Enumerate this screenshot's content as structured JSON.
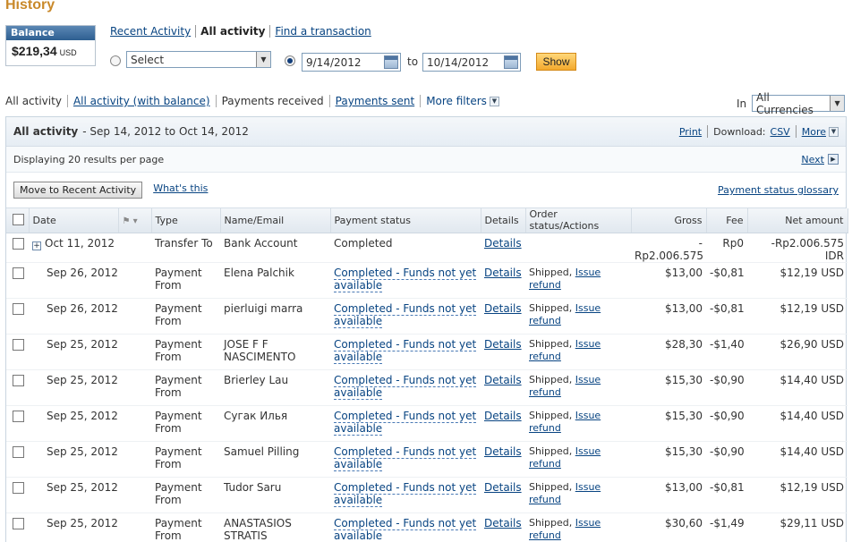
{
  "page_title": "History",
  "balance": {
    "label": "Balance",
    "amount": "$219,34",
    "currency": "USD"
  },
  "top_tabs": {
    "recent": "Recent Activity",
    "all": "All activity",
    "find": "Find a transaction"
  },
  "select": {
    "value": "Select"
  },
  "dates": {
    "from": "9/14/2012",
    "to_label": "to",
    "to": "10/14/2012"
  },
  "show_button": "Show",
  "filter_tabs": {
    "all": "All activity",
    "all_balance": "All activity (with balance)",
    "received": "Payments received",
    "sent": "Payments sent",
    "more": "More filters"
  },
  "currency": {
    "in_label": "In",
    "value": "All Currencies"
  },
  "panel": {
    "title": "All activity",
    "range": "- Sep 14, 2012 to Oct 14, 2012",
    "print": "Print",
    "download_label": "Download:",
    "csv": "CSV",
    "more": "More",
    "displaying": "Displaying 20 results per page",
    "next": "Next",
    "move_button": "Move to Recent Activity",
    "whats_this": "What's this",
    "glossary": "Payment status glossary"
  },
  "columns": {
    "date": "Date",
    "type": "Type",
    "name": "Name/Email",
    "status": "Payment status",
    "details": "Details",
    "order": "Order status/Actions",
    "gross": "Gross",
    "fee": "Fee",
    "net": "Net amount"
  },
  "rows": [
    {
      "date": "Oct 11, 2012",
      "type1": "Transfer To",
      "type2": "",
      "name1": "Bank Account",
      "name2": "",
      "status1": "Completed",
      "status2": "",
      "details": "Details",
      "order": "",
      "refund": "",
      "gross": "-Rp2.006.575",
      "fee": "Rp0",
      "net": "-Rp2.006.575 IDR"
    },
    {
      "date": "Sep 26, 2012",
      "type1": "Payment",
      "type2": "From",
      "name1": "Elena Palchik",
      "name2": "",
      "status1": "Completed - Funds not yet",
      "status2": "available",
      "details": "Details",
      "order": "Shipped,",
      "refund": "Issue refund",
      "gross": "$13,00",
      "fee": "-$0,81",
      "net": "$12,19 USD"
    },
    {
      "date": "Sep 26, 2012",
      "type1": "Payment",
      "type2": "From",
      "name1": "pierluigi marra",
      "name2": "",
      "status1": "Completed - Funds not yet",
      "status2": "available",
      "details": "Details",
      "order": "Shipped,",
      "refund": "Issue refund",
      "gross": "$13,00",
      "fee": "-$0,81",
      "net": "$12,19 USD"
    },
    {
      "date": "Sep 25, 2012",
      "type1": "Payment",
      "type2": "From",
      "name1": "JOSE F F",
      "name2": "NASCIMENTO",
      "status1": "Completed - Funds not yet",
      "status2": "available",
      "details": "Details",
      "order": "Shipped,",
      "refund": "Issue refund",
      "gross": "$28,30",
      "fee": "-$1,40",
      "net": "$26,90 USD"
    },
    {
      "date": "Sep 25, 2012",
      "type1": "Payment",
      "type2": "From",
      "name1": "Brierley Lau",
      "name2": "",
      "status1": "Completed - Funds not yet",
      "status2": "available",
      "details": "Details",
      "order": "Shipped,",
      "refund": "Issue refund",
      "gross": "$15,30",
      "fee": "-$0,90",
      "net": "$14,40 USD"
    },
    {
      "date": "Sep 25, 2012",
      "type1": "Payment",
      "type2": "From",
      "name1": "Сугак Илья",
      "name2": "",
      "status1": "Completed - Funds not yet",
      "status2": "available",
      "details": "Details",
      "order": "Shipped,",
      "refund": "Issue refund",
      "gross": "$15,30",
      "fee": "-$0,90",
      "net": "$14,40 USD"
    },
    {
      "date": "Sep 25, 2012",
      "type1": "Payment",
      "type2": "From",
      "name1": "Samuel Pilling",
      "name2": "",
      "status1": "Completed - Funds not yet",
      "status2": "available",
      "details": "Details",
      "order": "Shipped,",
      "refund": "Issue refund",
      "gross": "$15,30",
      "fee": "-$0,90",
      "net": "$14,40 USD"
    },
    {
      "date": "Sep 25, 2012",
      "type1": "Payment",
      "type2": "From",
      "name1": "Tudor Saru",
      "name2": "",
      "status1": "Completed - Funds not yet",
      "status2": "available",
      "details": "Details",
      "order": "Shipped,",
      "refund": "Issue refund",
      "gross": "$13,00",
      "fee": "-$0,81",
      "net": "$12,19 USD"
    },
    {
      "date": "Sep 25, 2012",
      "type1": "Payment",
      "type2": "From",
      "name1": "ANASTASIOS",
      "name2": "STRATIS",
      "status1": "Completed - Funds not yet",
      "status2": "available",
      "details": "Details",
      "order": "Shipped,",
      "refund": "Issue refund",
      "gross": "$30,60",
      "fee": "-$1,49",
      "net": "$29,11 USD"
    }
  ]
}
